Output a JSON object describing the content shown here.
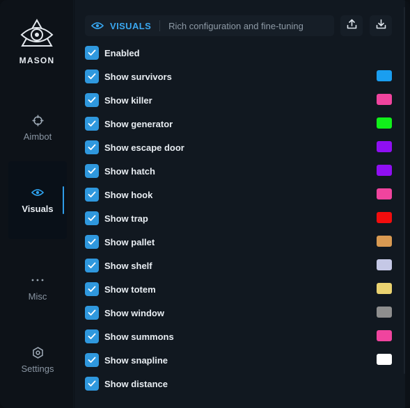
{
  "brand": {
    "name": "MASON"
  },
  "sidebar": {
    "items": [
      {
        "label": "Aimbot",
        "icon": "crosshair-icon",
        "active": false
      },
      {
        "label": "Visuals",
        "icon": "eye-icon",
        "active": true
      },
      {
        "label": "Misc",
        "icon": "more-dots-icon",
        "active": false
      },
      {
        "label": "Settings",
        "icon": "settings-gear-icon",
        "active": false
      }
    ]
  },
  "header": {
    "title": "VISUALS",
    "subtitle": "Rich configuration and fine-tuning",
    "icon": "eye-icon",
    "export_icon": "upload-icon",
    "import_icon": "download-icon"
  },
  "options": [
    {
      "label": "Enabled",
      "checked": true,
      "color": null
    },
    {
      "label": "Show survivors",
      "checked": true,
      "color": "#1a9ef0"
    },
    {
      "label": "Show killer",
      "checked": true,
      "color": "#f0449e"
    },
    {
      "label": "Show generator",
      "checked": true,
      "color": "#11f01a"
    },
    {
      "label": "Show escape door",
      "checked": true,
      "color": "#8f0ff2"
    },
    {
      "label": "Show hatch",
      "checked": true,
      "color": "#8f0ff2"
    },
    {
      "label": "Show hook",
      "checked": true,
      "color": "#f0449e"
    },
    {
      "label": "Show trap",
      "checked": true,
      "color": "#f20d0d"
    },
    {
      "label": "Show pallet",
      "checked": true,
      "color": "#d99a52"
    },
    {
      "label": "Show shelf",
      "checked": true,
      "color": "#c5c8e6"
    },
    {
      "label": "Show totem",
      "checked": true,
      "color": "#ead270"
    },
    {
      "label": "Show window",
      "checked": true,
      "color": "#8e8e8e"
    },
    {
      "label": "Show summons",
      "checked": true,
      "color": "#f0449e"
    },
    {
      "label": "Show snapline",
      "checked": true,
      "color": "#ffffff"
    },
    {
      "label": "Show distance",
      "checked": true,
      "color": null
    }
  ],
  "colors": {
    "accent": "#2f98de",
    "checkbox": "#2f98de"
  }
}
